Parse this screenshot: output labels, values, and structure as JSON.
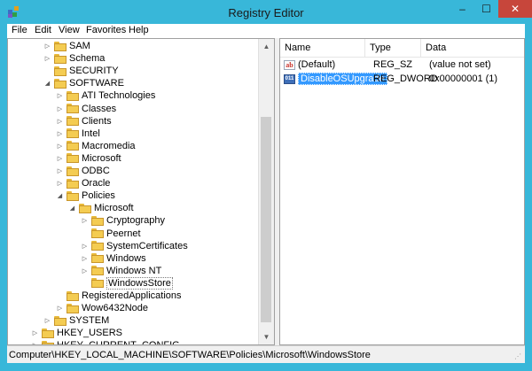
{
  "window": {
    "title": "Registry Editor",
    "minimize": "–",
    "maximize": "☐",
    "close": "✕"
  },
  "menu": [
    "File",
    "Edit",
    "View",
    "Favorites",
    "Help"
  ],
  "tree": [
    {
      "label": "SAM",
      "expander": "▷",
      "depth": 0
    },
    {
      "label": "Schema",
      "expander": "▷",
      "depth": 0
    },
    {
      "label": "SECURITY",
      "expander": "",
      "depth": 0
    },
    {
      "label": "SOFTWARE",
      "expander": "◢",
      "depth": 0
    },
    {
      "label": "ATI Technologies",
      "expander": "▷",
      "depth": 1
    },
    {
      "label": "Classes",
      "expander": "▷",
      "depth": 1
    },
    {
      "label": "Clients",
      "expander": "▷",
      "depth": 1
    },
    {
      "label": "Intel",
      "expander": "▷",
      "depth": 1
    },
    {
      "label": "Macromedia",
      "expander": "▷",
      "depth": 1
    },
    {
      "label": "Microsoft",
      "expander": "▷",
      "depth": 1
    },
    {
      "label": "ODBC",
      "expander": "▷",
      "depth": 1
    },
    {
      "label": "Oracle",
      "expander": "▷",
      "depth": 1
    },
    {
      "label": "Policies",
      "expander": "◢",
      "depth": 1
    },
    {
      "label": "Microsoft",
      "expander": "◢",
      "depth": 2
    },
    {
      "label": "Cryptography",
      "expander": "▷",
      "depth": 3
    },
    {
      "label": "Peernet",
      "expander": "",
      "depth": 3
    },
    {
      "label": "SystemCertificates",
      "expander": "▷",
      "depth": 3
    },
    {
      "label": "Windows",
      "expander": "▷",
      "depth": 3
    },
    {
      "label": "Windows NT",
      "expander": "▷",
      "depth": 3
    },
    {
      "label": "WindowsStore",
      "expander": "",
      "depth": 3,
      "selected": true
    },
    {
      "label": "RegisteredApplications",
      "expander": "",
      "depth": 1
    },
    {
      "label": "Wow6432Node",
      "expander": "▷",
      "depth": 1
    },
    {
      "label": "SYSTEM",
      "expander": "▷",
      "depth": 0
    },
    {
      "label": "HKEY_USERS",
      "expander": "▷",
      "depth": -1
    },
    {
      "label": "HKEY_CURRENT_CONFIG",
      "expander": "▷",
      "depth": -1
    }
  ],
  "columns": [
    "Name",
    "Type",
    "Data"
  ],
  "values": [
    {
      "icon": "ab",
      "name": "(Default)",
      "type": "REG_SZ",
      "data": "(value not set)",
      "selected": false
    },
    {
      "icon": "bin",
      "name": "DisableOSUpgrade",
      "type": "REG_DWORD",
      "data": "0x00000001 (1)",
      "selected": true
    }
  ],
  "status": {
    "path": "Computer\\HKEY_LOCAL_MACHINE\\SOFTWARE\\Policies\\Microsoft\\WindowsStore"
  },
  "icons": {
    "ab_glyph": "ab",
    "bin_glyph": "011",
    "scroll_up": "▲",
    "scroll_down": "▼",
    "grip": "⋰"
  }
}
